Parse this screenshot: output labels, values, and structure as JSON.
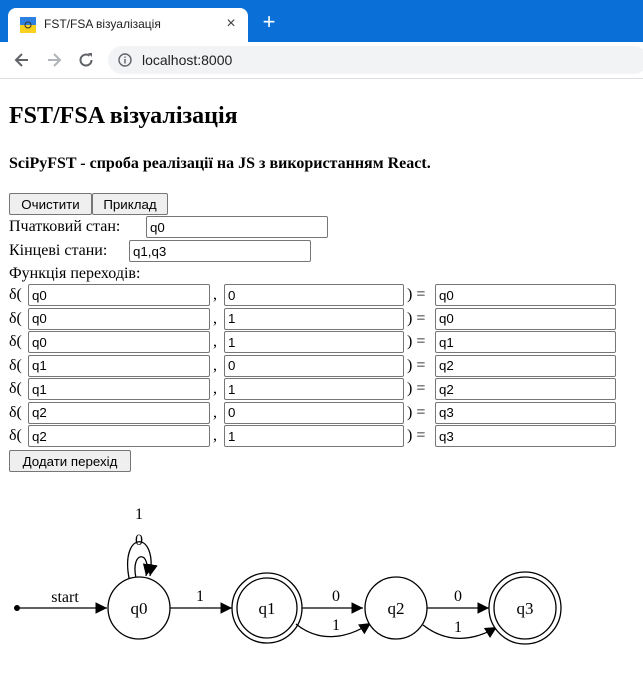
{
  "browser": {
    "tab_title": "FST/FSA візуалізація",
    "tab_close": "×",
    "new_tab": "+",
    "url": "localhost:8000"
  },
  "page": {
    "heading": "FST/FSA візуалізація",
    "subtitle": "SciPyFST - спроба реалізації на JS з використанням React.",
    "clear_button": "Очистити",
    "example_button": "Приклад",
    "initial_state_label": "Пчатковий стан:",
    "initial_state_value": "q0",
    "final_states_label": "Кінцеві стани:",
    "final_states_value": "q1,q3",
    "transitions_label": "Функція переходів:",
    "delta_open": "δ(",
    "comma": ",",
    "close_eq": ") =",
    "transitions": [
      {
        "from": "q0",
        "input": "0",
        "to": "q0"
      },
      {
        "from": "q0",
        "input": "1",
        "to": "q0"
      },
      {
        "from": "q0",
        "input": "1",
        "to": "q1"
      },
      {
        "from": "q1",
        "input": "0",
        "to": "q2"
      },
      {
        "from": "q1",
        "input": "1",
        "to": "q2"
      },
      {
        "from": "q2",
        "input": "0",
        "to": "q3"
      },
      {
        "from": "q2",
        "input": "1",
        "to": "q3"
      }
    ],
    "add_transition_button": "Додати перехід"
  },
  "graph": {
    "start_label": "start",
    "states": [
      "q0",
      "q1",
      "q2",
      "q3"
    ],
    "final_states": [
      "q1",
      "q3"
    ],
    "edge_labels": {
      "loop_outer": "1",
      "loop_inner": "0",
      "q0_q1": "1",
      "q1_q2_top": "0",
      "q1_q2_bottom": "1",
      "q2_q3_top": "0",
      "q2_q3_bottom": "1"
    }
  }
}
